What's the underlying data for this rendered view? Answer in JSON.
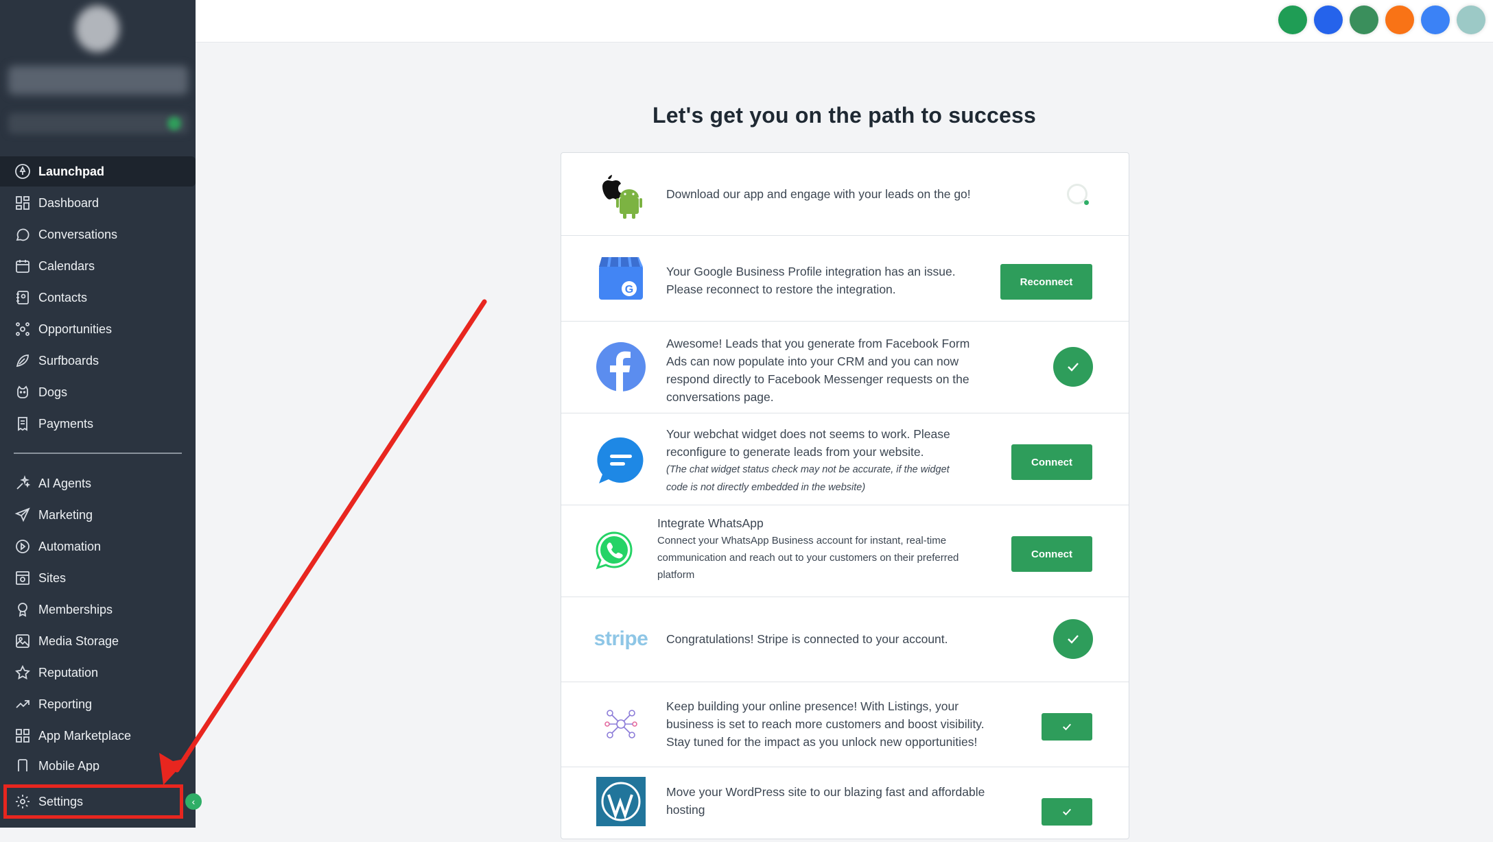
{
  "sidebar": {
    "items": [
      {
        "label": "Launchpad",
        "icon": "rocket-icon"
      },
      {
        "label": "Dashboard",
        "icon": "grid-icon"
      },
      {
        "label": "Conversations",
        "icon": "chat-bubble-icon"
      },
      {
        "label": "Calendars",
        "icon": "calendar-icon"
      },
      {
        "label": "Contacts",
        "icon": "contacts-icon"
      },
      {
        "label": "Opportunities",
        "icon": "opportunities-icon"
      },
      {
        "label": "Surfboards",
        "icon": "surfboard-icon"
      },
      {
        "label": "Dogs",
        "icon": "dog-icon"
      },
      {
        "label": "Payments",
        "icon": "receipt-icon"
      }
    ],
    "items2": [
      {
        "label": "AI Agents",
        "icon": "sparkles-icon"
      },
      {
        "label": "Marketing",
        "icon": "send-icon"
      },
      {
        "label": "Automation",
        "icon": "automation-icon"
      },
      {
        "label": "Sites",
        "icon": "sites-icon"
      },
      {
        "label": "Memberships",
        "icon": "badge-icon"
      },
      {
        "label": "Media Storage",
        "icon": "image-icon"
      },
      {
        "label": "Reputation",
        "icon": "star-icon"
      },
      {
        "label": "Reporting",
        "icon": "trend-icon"
      },
      {
        "label": "App Marketplace",
        "icon": "apps-icon"
      },
      {
        "label": "Mobile App",
        "icon": "mobile-icon"
      }
    ],
    "settings_label": "Settings",
    "active": "Launchpad"
  },
  "header": {
    "icons": [
      "phone-icon",
      "compass-icon",
      "megaphone-icon",
      "bell-icon",
      "help-icon",
      "avatar-icon"
    ],
    "icon_colors": [
      "#1f9d55",
      "#2563eb",
      "#3a8f5c",
      "#f97316",
      "#3b82f6",
      "#9cc9c6"
    ]
  },
  "main": {
    "title": "Let's get you on the path to success",
    "rows": [
      {
        "text": "Download our app and engage with your leads on the go!",
        "status": "loading"
      },
      {
        "text1": "Your Google Business Profile integration has an issue.",
        "text2": "Please reconnect to restore the integration.",
        "button": "Reconnect"
      },
      {
        "lines": [
          "Awesome! Leads that you generate from Facebook Form",
          "Ads can now populate into your CRM and you can now",
          "respond directly to Facebook Messenger requests on the",
          "conversations page."
        ],
        "status": "connected"
      },
      {
        "lines": [
          "Your webchat widget does not seems to work. Please",
          "reconfigure to generate leads from your website."
        ],
        "note": [
          "(The chat widget status check may not be accurate, if the widget",
          "code is not directly embedded in the website)"
        ],
        "button": "Connect"
      },
      {
        "title": "Integrate WhatsApp",
        "sub": [
          "Connect your WhatsApp Business account for instant, real-time",
          "communication and reach out to your customers on their preferred",
          "platform"
        ],
        "button": "Connect"
      },
      {
        "text": "Congratulations! Stripe is connected to your account.",
        "logo": "stripe",
        "status": "connected"
      },
      {
        "lines": [
          "Keep building your online presence! With Listings, your",
          "business is set to reach more customers and boost visibility.",
          "Stay tuned for the impact as you unlock new opportunities!"
        ],
        "status": "connected"
      },
      {
        "lines": [
          "Move your WordPress site to our blazing fast and affordable",
          "hosting"
        ],
        "status": "connected"
      }
    ]
  },
  "colors": {
    "accent": "#2e9d5b",
    "sidebar_bg": "#2b3440",
    "highlight": "#e8261f"
  }
}
